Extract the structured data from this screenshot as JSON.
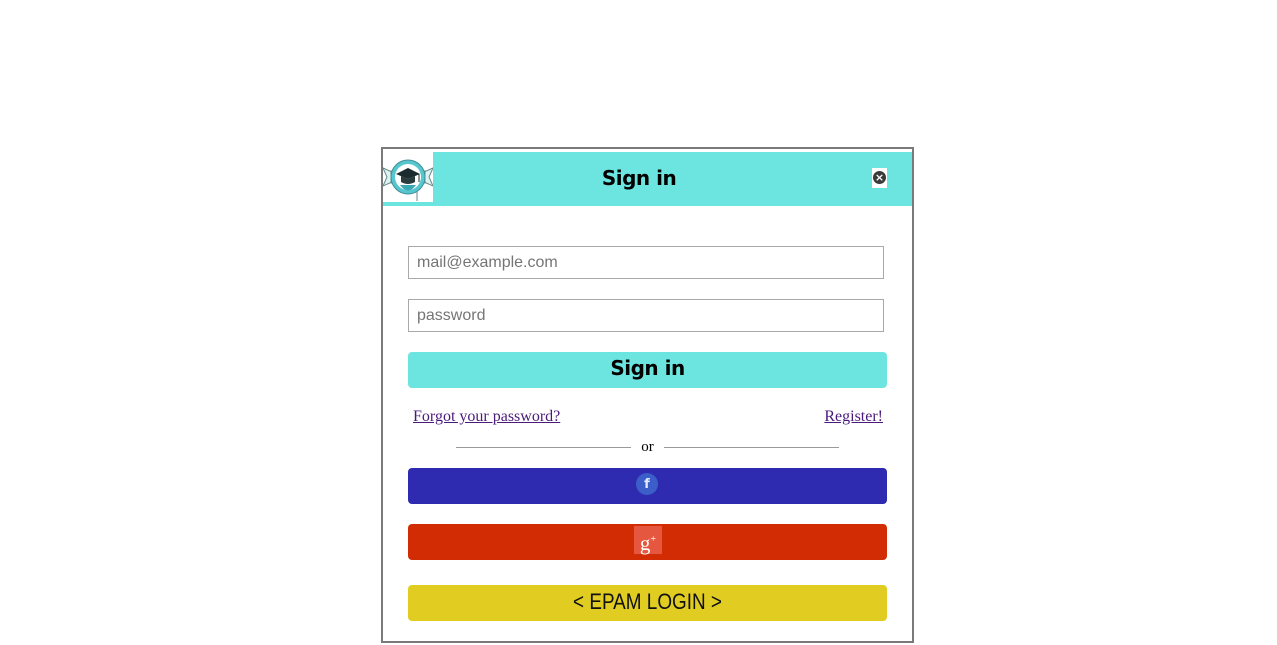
{
  "header": {
    "title": "Sign in",
    "close_glyph": "×"
  },
  "form": {
    "email_placeholder": "mail@example.com",
    "password_placeholder": "password",
    "submit_label": "Sign in"
  },
  "links": {
    "forgot": "Forgot your password?",
    "register": "Register!"
  },
  "divider": {
    "text": "or"
  },
  "social": {
    "facebook_glyph": "f",
    "google_glyph": "g",
    "google_plus": "+"
  },
  "epam": {
    "label": "< EPAM LOGIN >"
  },
  "colors": {
    "header_bg": "#6ce5e1",
    "facebook": "#2e2bb0",
    "google": "#d22c05",
    "epam": "#e1cd22"
  },
  "icons": [
    "graduation-cap-logo-icon",
    "close-icon",
    "facebook-icon",
    "google-plus-icon"
  ]
}
